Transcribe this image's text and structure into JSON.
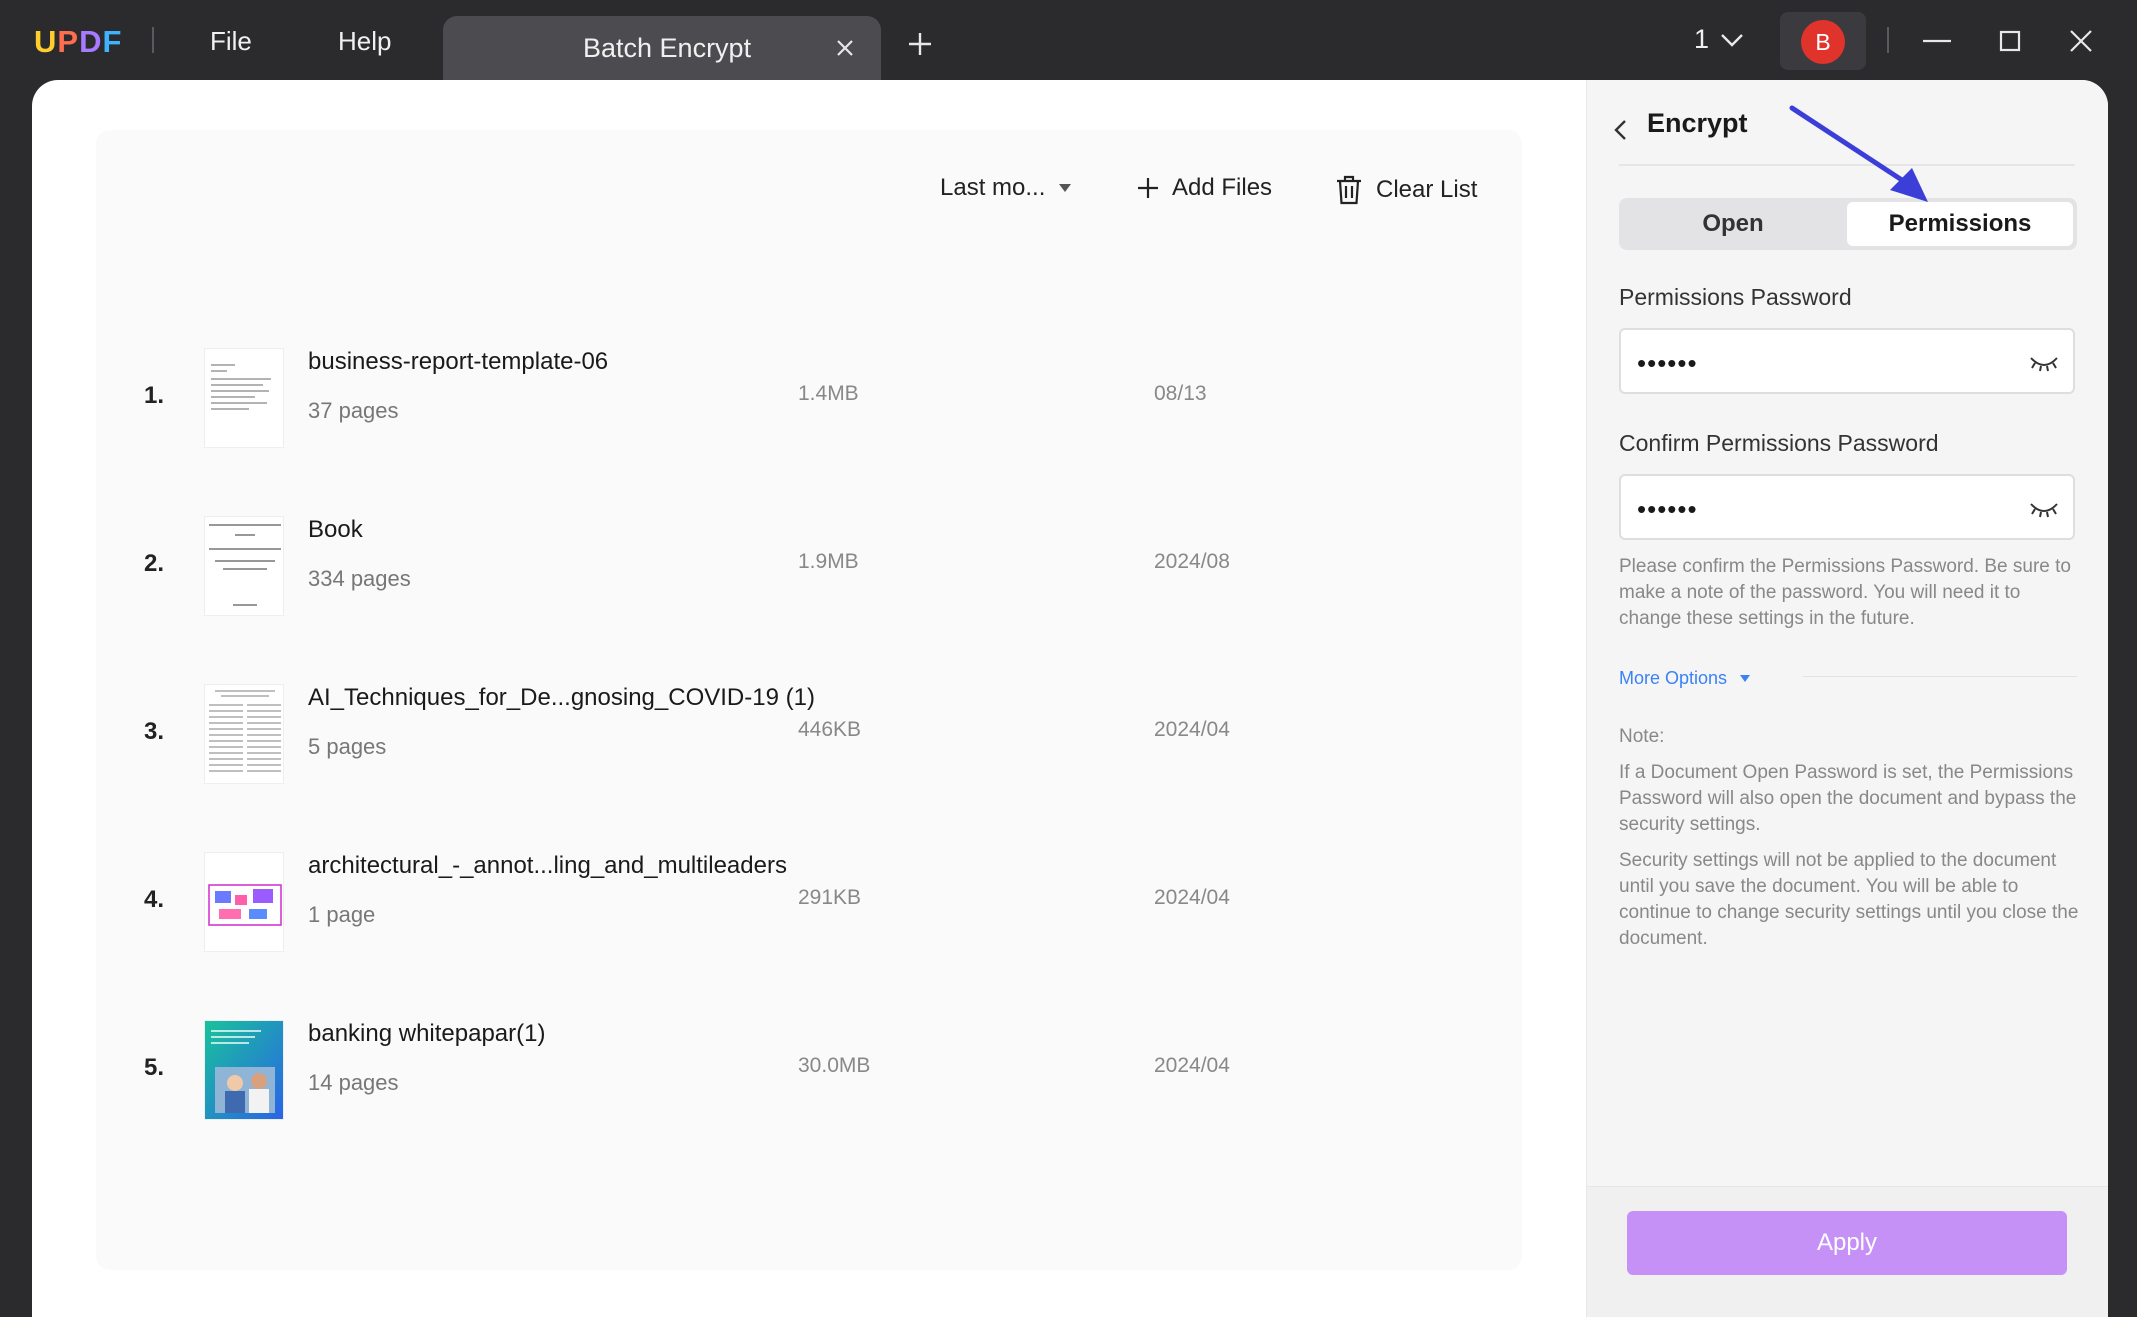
{
  "app": {
    "logo": [
      "U",
      "P",
      "D",
      "F"
    ],
    "menu": {
      "file": "File",
      "help": "Help"
    },
    "tab": {
      "label": "Batch Encrypt"
    },
    "page_count": "1",
    "avatar_letter": "B"
  },
  "toolbar": {
    "sort_label": "Last mo...",
    "add_files": "Add Files",
    "clear_list": "Clear List"
  },
  "files": [
    {
      "num": "1.",
      "name": "business-report-template-06",
      "pages": "37 pages",
      "size": "1.4MB",
      "date": "08/13"
    },
    {
      "num": "2.",
      "name": "Book",
      "pages": "334 pages",
      "size": "1.9MB",
      "date": "2024/08"
    },
    {
      "num": "3.",
      "name": "AI_Techniques_for_De...gnosing_COVID-19 (1)",
      "pages": "5 pages",
      "size": "446KB",
      "date": "2024/04"
    },
    {
      "num": "4.",
      "name": "architectural_-_annot...ling_and_multileaders",
      "pages": "1 page",
      "size": "291KB",
      "date": "2024/04"
    },
    {
      "num": "5.",
      "name": "banking whitepapar(1)",
      "pages": "14 pages",
      "size": "30.0MB",
      "date": "2024/04"
    }
  ],
  "panel": {
    "title": "Encrypt",
    "tabs": {
      "open": "Open",
      "permissions": "Permissions"
    },
    "perm_password_label": "Permissions Password",
    "perm_password_value": "••••••",
    "confirm_label": "Confirm Permissions Password",
    "confirm_value": "••••••",
    "help": "Please confirm the Permissions Password. Be sure to make a note of the password. You will need it to change these settings in the future.",
    "more_options": "More Options",
    "note_heading": "Note:",
    "note_1": "If a Document Open Password is set, the Permissions Password will also open the document and bypass the security settings.",
    "note_2": "Security settings will not be applied to the document until you save the document. You will be able to continue to change security settings until you close the document.",
    "apply": "Apply"
  },
  "colors": {
    "accent": "#c591f7",
    "link": "#3b82f6",
    "avatar": "#e0332b",
    "annotation_arrow": "#3b3fd8"
  }
}
